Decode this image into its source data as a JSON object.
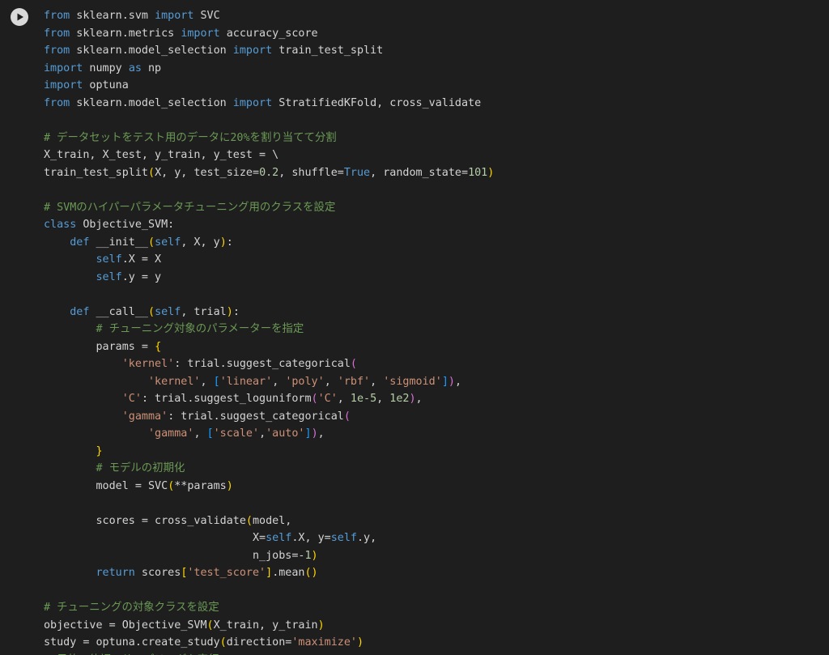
{
  "run_button": {
    "icon": "play-icon"
  },
  "colors": {
    "background": "#1e1e1e",
    "text": "#d4d4d4",
    "keyword": "#569cd6",
    "comment": "#6a9955",
    "string": "#ce9178",
    "number": "#b5cea8",
    "bracket_1": "#ffd700",
    "bracket_2": "#da70d6",
    "bracket_3": "#179fff"
  },
  "code_lines": [
    [
      {
        "t": "from",
        "c": "kw"
      },
      {
        "t": " sklearn.svm "
      },
      {
        "t": "import",
        "c": "kw"
      },
      {
        "t": " SVC"
      }
    ],
    [
      {
        "t": "from",
        "c": "kw"
      },
      {
        "t": " sklearn.metrics "
      },
      {
        "t": "import",
        "c": "kw"
      },
      {
        "t": " accuracy_score"
      }
    ],
    [
      {
        "t": "from",
        "c": "kw"
      },
      {
        "t": " sklearn.model_selection "
      },
      {
        "t": "import",
        "c": "kw"
      },
      {
        "t": " train_test_split"
      }
    ],
    [
      {
        "t": "import",
        "c": "kw"
      },
      {
        "t": " numpy "
      },
      {
        "t": "as",
        "c": "kw"
      },
      {
        "t": " np"
      }
    ],
    [
      {
        "t": "import",
        "c": "kw"
      },
      {
        "t": " optuna"
      }
    ],
    [
      {
        "t": "from",
        "c": "kw"
      },
      {
        "t": " sklearn.model_selection "
      },
      {
        "t": "import",
        "c": "kw"
      },
      {
        "t": " StratifiedKFold, cross_validate"
      }
    ],
    [],
    [
      {
        "t": "# データセットをテスト用のデータに20%を割り当てて分割",
        "c": "cm"
      }
    ],
    [
      {
        "t": "X_train, X_test, y_train, y_test = \\"
      }
    ],
    [
      {
        "t": "train_test_split"
      },
      {
        "t": "(",
        "c": "p1"
      },
      {
        "t": "X, y, test_size="
      },
      {
        "t": "0.2",
        "c": "num"
      },
      {
        "t": ", shuffle="
      },
      {
        "t": "True",
        "c": "kw"
      },
      {
        "t": ", random_state="
      },
      {
        "t": "101",
        "c": "num"
      },
      {
        "t": ")",
        "c": "p1"
      }
    ],
    [],
    [
      {
        "t": "# SVMのハイパーパラメータチューニング用のクラスを設定",
        "c": "cm"
      }
    ],
    [
      {
        "t": "class",
        "c": "kw"
      },
      {
        "t": " Objective_SVM:"
      }
    ],
    [
      {
        "t": "    "
      },
      {
        "t": "def",
        "c": "kw"
      },
      {
        "t": " __init__"
      },
      {
        "t": "(",
        "c": "p1"
      },
      {
        "t": "self",
        "c": "slf"
      },
      {
        "t": ", X, y"
      },
      {
        "t": ")",
        "c": "p1"
      },
      {
        "t": ":"
      }
    ],
    [
      {
        "t": "        "
      },
      {
        "t": "self",
        "c": "slf"
      },
      {
        "t": ".X = X"
      }
    ],
    [
      {
        "t": "        "
      },
      {
        "t": "self",
        "c": "slf"
      },
      {
        "t": ".y = y"
      }
    ],
    [],
    [
      {
        "t": "    "
      },
      {
        "t": "def",
        "c": "kw"
      },
      {
        "t": " __call__"
      },
      {
        "t": "(",
        "c": "p1"
      },
      {
        "t": "self",
        "c": "slf"
      },
      {
        "t": ", trial"
      },
      {
        "t": ")",
        "c": "p1"
      },
      {
        "t": ":"
      }
    ],
    [
      {
        "t": "        "
      },
      {
        "t": "# チューニング対象のパラメーターを指定",
        "c": "cm"
      }
    ],
    [
      {
        "t": "        params = "
      },
      {
        "t": "{",
        "c": "p1"
      }
    ],
    [
      {
        "t": "            "
      },
      {
        "t": "'kernel'",
        "c": "str"
      },
      {
        "t": ": trial.suggest_categorical"
      },
      {
        "t": "(",
        "c": "p2"
      }
    ],
    [
      {
        "t": "                "
      },
      {
        "t": "'kernel'",
        "c": "str"
      },
      {
        "t": ", "
      },
      {
        "t": "[",
        "c": "p3"
      },
      {
        "t": "'linear'",
        "c": "str"
      },
      {
        "t": ", "
      },
      {
        "t": "'poly'",
        "c": "str"
      },
      {
        "t": ", "
      },
      {
        "t": "'rbf'",
        "c": "str"
      },
      {
        "t": ", "
      },
      {
        "t": "'sigmoid'",
        "c": "str"
      },
      {
        "t": "]",
        "c": "p3"
      },
      {
        "t": ")",
        "c": "p2"
      },
      {
        "t": ","
      }
    ],
    [
      {
        "t": "            "
      },
      {
        "t": "'C'",
        "c": "str"
      },
      {
        "t": ": trial.suggest_loguniform"
      },
      {
        "t": "(",
        "c": "p2"
      },
      {
        "t": "'C'",
        "c": "str"
      },
      {
        "t": ", "
      },
      {
        "t": "1e-5",
        "c": "num"
      },
      {
        "t": ", "
      },
      {
        "t": "1e2",
        "c": "num"
      },
      {
        "t": ")",
        "c": "p2"
      },
      {
        "t": ","
      }
    ],
    [
      {
        "t": "            "
      },
      {
        "t": "'gamma'",
        "c": "str"
      },
      {
        "t": ": trial.suggest_categorical"
      },
      {
        "t": "(",
        "c": "p2"
      }
    ],
    [
      {
        "t": "                "
      },
      {
        "t": "'gamma'",
        "c": "str"
      },
      {
        "t": ", "
      },
      {
        "t": "[",
        "c": "p3"
      },
      {
        "t": "'scale'",
        "c": "str"
      },
      {
        "t": ","
      },
      {
        "t": "'auto'",
        "c": "str"
      },
      {
        "t": "]",
        "c": "p3"
      },
      {
        "t": ")",
        "c": "p2"
      },
      {
        "t": ","
      }
    ],
    [
      {
        "t": "        "
      },
      {
        "t": "}",
        "c": "p1"
      }
    ],
    [
      {
        "t": "        "
      },
      {
        "t": "# モデルの初期化",
        "c": "cm"
      }
    ],
    [
      {
        "t": "        model = SVC"
      },
      {
        "t": "(",
        "c": "p1"
      },
      {
        "t": "**params"
      },
      {
        "t": ")",
        "c": "p1"
      }
    ],
    [],
    [
      {
        "t": "        scores = cross_validate"
      },
      {
        "t": "(",
        "c": "p1"
      },
      {
        "t": "model,"
      }
    ],
    [
      {
        "t": "                                X="
      },
      {
        "t": "self",
        "c": "slf"
      },
      {
        "t": ".X, y="
      },
      {
        "t": "self",
        "c": "slf"
      },
      {
        "t": ".y,"
      }
    ],
    [
      {
        "t": "                                n_jobs=-"
      },
      {
        "t": "1",
        "c": "num"
      },
      {
        "t": ")",
        "c": "p1"
      }
    ],
    [
      {
        "t": "        "
      },
      {
        "t": "return",
        "c": "kw"
      },
      {
        "t": " scores"
      },
      {
        "t": "[",
        "c": "p1"
      },
      {
        "t": "'test_score'",
        "c": "str"
      },
      {
        "t": "]",
        "c": "p1"
      },
      {
        "t": ".mean"
      },
      {
        "t": "()",
        "c": "p1"
      }
    ],
    [],
    [
      {
        "t": "# チューニングの対象クラスを設定",
        "c": "cm"
      }
    ],
    [
      {
        "t": "objective = Objective_SVM"
      },
      {
        "t": "(",
        "c": "p1"
      },
      {
        "t": "X_train, y_train"
      },
      {
        "t": ")",
        "c": "p1"
      }
    ],
    [
      {
        "t": "study = optuna.create_study"
      },
      {
        "t": "(",
        "c": "p1"
      },
      {
        "t": "direction="
      },
      {
        "t": "'maximize'",
        "c": "str"
      },
      {
        "t": ")",
        "c": "p1"
      }
    ],
    [
      {
        "t": "# 目的の体調のサンプリングを実行",
        "c": "cm"
      }
    ]
  ]
}
